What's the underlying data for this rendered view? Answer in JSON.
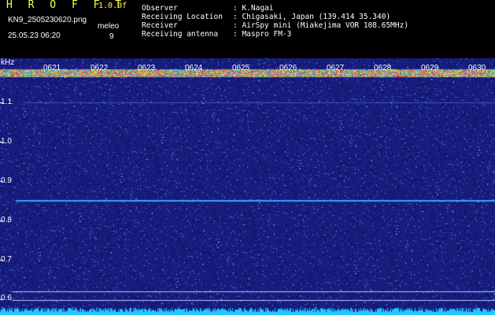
{
  "header": {
    "app_title": "H R O F F T",
    "version": "1.0.0f",
    "filename": "KN9_2505230620.png",
    "datetime": "25.05.23 06:20",
    "meleo_label": "meleo",
    "meleo_value": "9",
    "info": [
      {
        "label": "Observer",
        "value": ": K.Nagai"
      },
      {
        "label": "Receiving Location",
        "value": ": Chigasaki, Japan (139.414 35.340)"
      },
      {
        "label": "Receiver",
        "value": ": AirSpy mini (Miakejima VOR 108.65MHz)"
      },
      {
        "label": "Receiving antenna",
        "value": ": Maspro FM-3"
      }
    ]
  },
  "y_axis": {
    "unit": "kHz",
    "ticks": [
      "1.1",
      "1.0",
      "0.9",
      "0.8",
      "0.7",
      "0.6"
    ]
  },
  "time_axis": {
    "ticks": [
      "0621",
      "0622",
      "0623",
      "0624",
      "0625",
      "0626",
      "0627",
      "0628",
      "0629",
      "0630"
    ]
  },
  "colors": {
    "background": "#000000",
    "noise_base": "#141c78",
    "carrier_line": "#3aa0ff",
    "top_band": "#e04040",
    "bottom_band": "#20c8ff",
    "title_yellow": "#ffff40"
  }
}
